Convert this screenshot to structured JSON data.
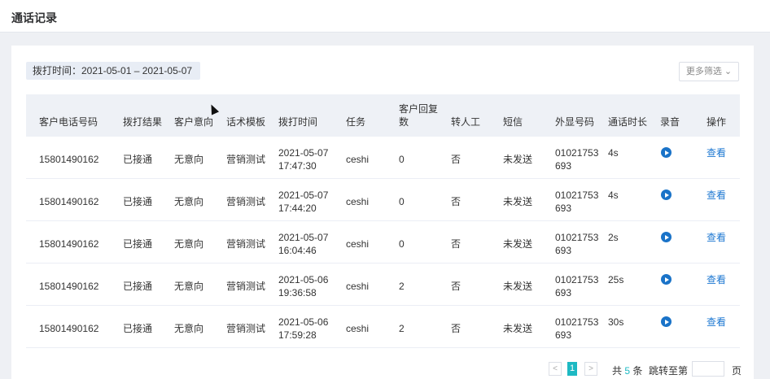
{
  "page": {
    "title": "通话记录"
  },
  "filters": {
    "date_range": "拨打时间：2021-05-01 – 2021-05-07",
    "more_filter": "更多筛选 ⌄"
  },
  "table": {
    "headers": [
      "客户电话号码",
      "拨打结果",
      "客户意向",
      "话术模板",
      "拨打时间",
      "任务",
      "客户回复数",
      "转人工",
      "短信",
      "外显号码",
      "通话时长",
      "录音",
      "操作"
    ],
    "header_reply_line1": "客户回复",
    "header_reply_line2": "数",
    "rows": [
      {
        "phone": "15801490162",
        "result": "已接通",
        "intent": "无意向",
        "template": "营销测试",
        "date": "2021-05-07",
        "time": "17:47:30",
        "task": "ceshi",
        "reply": "0",
        "transfer": "否",
        "sms": "未发送",
        "caller_a": "01021753",
        "caller_b": "693",
        "duration": "4s",
        "action": "查看"
      },
      {
        "phone": "15801490162",
        "result": "已接通",
        "intent": "无意向",
        "template": "营销测试",
        "date": "2021-05-07",
        "time": "17:44:20",
        "task": "ceshi",
        "reply": "0",
        "transfer": "否",
        "sms": "未发送",
        "caller_a": "01021753",
        "caller_b": "693",
        "duration": "4s",
        "action": "查看"
      },
      {
        "phone": "15801490162",
        "result": "已接通",
        "intent": "无意向",
        "template": "营销测试",
        "date": "2021-05-07",
        "time": "16:04:46",
        "task": "ceshi",
        "reply": "0",
        "transfer": "否",
        "sms": "未发送",
        "caller_a": "01021753",
        "caller_b": "693",
        "duration": "2s",
        "action": "查看"
      },
      {
        "phone": "15801490162",
        "result": "已接通",
        "intent": "无意向",
        "template": "营销测试",
        "date": "2021-05-06",
        "time": "19:36:58",
        "task": "ceshi",
        "reply": "2",
        "transfer": "否",
        "sms": "未发送",
        "caller_a": "01021753",
        "caller_b": "693",
        "duration": "25s",
        "action": "查看"
      },
      {
        "phone": "15801490162",
        "result": "已接通",
        "intent": "无意向",
        "template": "营销测试",
        "date": "2021-05-06",
        "time": "17:59:28",
        "task": "ceshi",
        "reply": "2",
        "transfer": "否",
        "sms": "未发送",
        "caller_a": "01021753",
        "caller_b": "693",
        "duration": "30s",
        "action": "查看"
      }
    ]
  },
  "pagination": {
    "prev": "<",
    "current": "1",
    "next": ">",
    "total_prefix": "共",
    "total": "5",
    "total_suffix": "条",
    "jump_label": "跳转至第",
    "page_suffix": "页"
  },
  "colors": {
    "accent": "#1db9c3",
    "link": "#1e78d2",
    "play": "#1a73c8",
    "header_bg": "#eef1f6"
  }
}
